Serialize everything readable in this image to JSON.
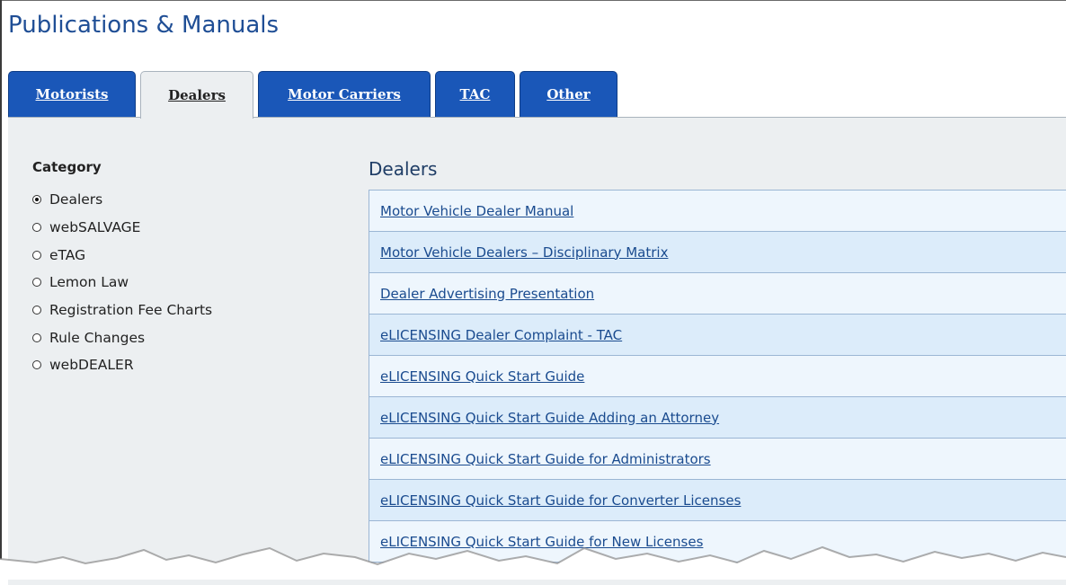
{
  "page": {
    "title": "Publications & Manuals"
  },
  "tabs": [
    {
      "label": "Motorists",
      "active": false
    },
    {
      "label": "Dealers",
      "active": true
    },
    {
      "label": "Motor Carriers",
      "active": false
    },
    {
      "label": "TAC",
      "active": false
    },
    {
      "label": "Other",
      "active": false
    }
  ],
  "category": {
    "title": "Category",
    "selected": "Dealers",
    "options": [
      "Dealers",
      "webSALVAGE",
      "eTAG",
      "Lemon Law",
      "Registration Fee Charts",
      "Rule Changes",
      "webDEALER"
    ]
  },
  "section": {
    "title": "Dealers",
    "links": [
      "Motor Vehicle Dealer Manual",
      "Motor Vehicle Dealers – Disciplinary Matrix",
      "Dealer Advertising Presentation",
      "eLICENSING Dealer Complaint - TAC",
      "eLICENSING Quick Start Guide",
      "eLICENSING Quick Start Guide Adding an Attorney",
      "eLICENSING Quick Start Guide for Administrators",
      "eLICENSING Quick Start Guide for Converter Licenses",
      "eLICENSING Quick Start Guide for New Licenses"
    ]
  },
  "colors": {
    "title": "#1f4e95",
    "tab_active_bg": "#eceff1",
    "tab_bg": "#1a57b8",
    "panel_bg": "#eceff1",
    "link": "#1a4b8f",
    "row_odd": "#eef6fd",
    "row_even": "#dcecfa"
  }
}
